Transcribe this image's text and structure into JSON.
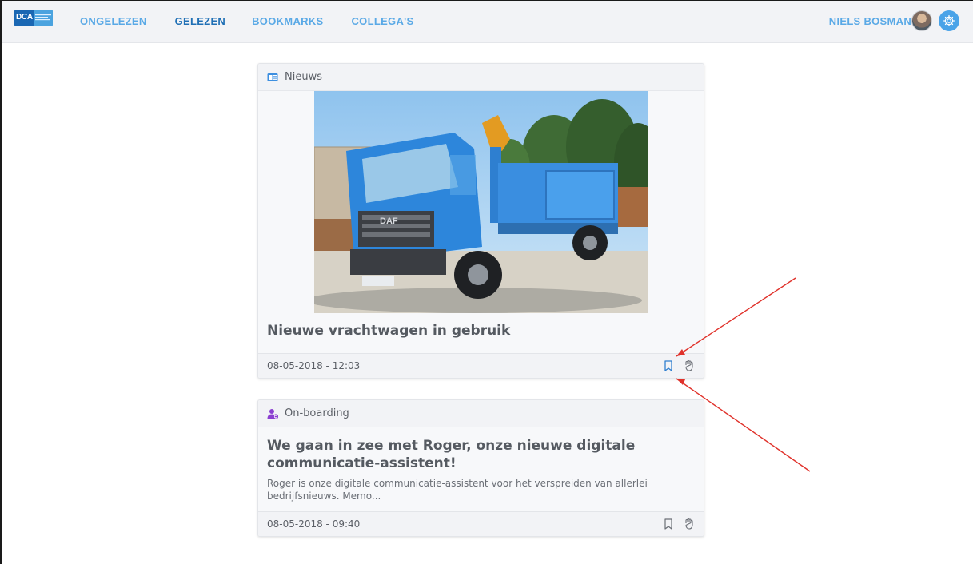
{
  "header": {
    "logo_text": "DCA",
    "nav": [
      {
        "label": "ONGELEZEN",
        "active": false
      },
      {
        "label": "GELEZEN",
        "active": true
      },
      {
        "label": "BOOKMARKS",
        "active": false
      },
      {
        "label": "COLLEGA'S",
        "active": false
      }
    ],
    "user_name": "NIELS BOSMANS",
    "settings_icon": "gear-icon",
    "accent_color": "#5aa9e6",
    "active_color": "#1f6fb5"
  },
  "cards": [
    {
      "category": "Nieuws",
      "category_icon": "newspaper-icon",
      "title": "Nieuwe vrachtwagen in gebruik",
      "date": "08-05-2018 - 12:03",
      "image": "photo of a blue DAF truck with crane",
      "actions": [
        "bookmark-icon",
        "thumbs-up-icon"
      ]
    },
    {
      "category": "On-boarding",
      "category_icon": "user-plus-icon",
      "title": "We gaan in zee met Roger, onze nieuwe digitale communicatie-assistent!",
      "excerpt": "Roger is onze digitale communicatie-assistent voor het verspreiden van allerlei bedrijfsnieuws. Memo...",
      "date": "08-05-2018 - 09:40",
      "actions": [
        "bookmark-icon",
        "thumbs-up-icon"
      ]
    }
  ],
  "annotation_color": "#e0322b"
}
